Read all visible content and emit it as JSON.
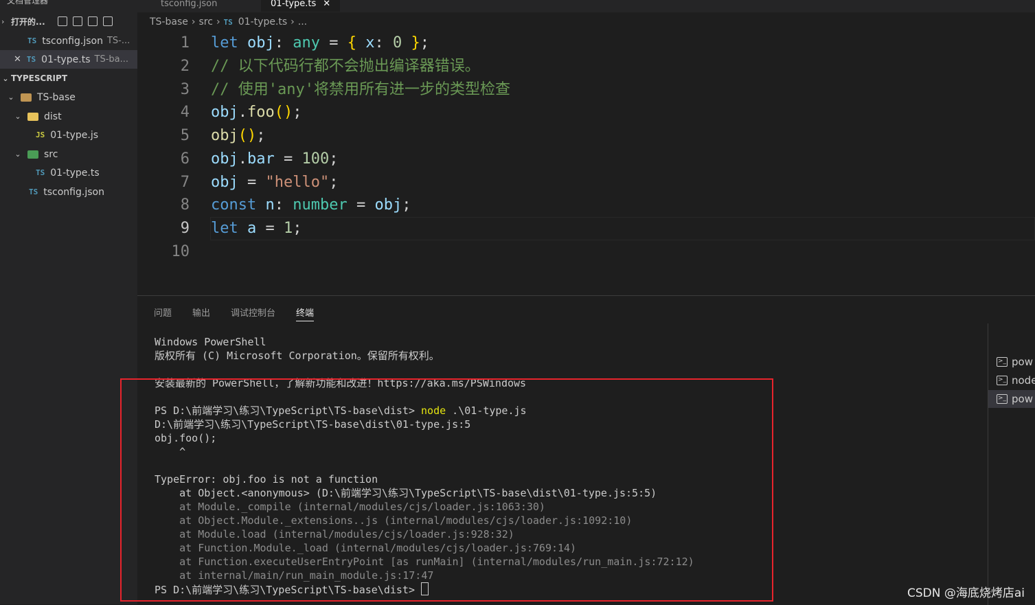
{
  "sidebar": {
    "cut_header": "文档管理器",
    "open_editors": {
      "title": "打开的...",
      "files": [
        {
          "tag": "TS",
          "name": "tsconfig.json",
          "desc": "TS-..."
        },
        {
          "tag": "TS",
          "name": "01-type.ts",
          "desc": "TS-ba..."
        }
      ]
    },
    "section_title": "TYPESCRIPT",
    "tree": {
      "root": "TS-base",
      "dist": "dist",
      "dist_file": {
        "tag": "JS",
        "name": "01-type.js"
      },
      "src": "src",
      "src_file": {
        "tag": "TS",
        "name": "01-type.ts"
      },
      "config_file": {
        "tag": "TS",
        "name": "tsconfig.json"
      }
    }
  },
  "tabs": [
    "tsconfig.json",
    "01-type.ts"
  ],
  "breadcrumb": {
    "a": "TS-base",
    "b": "src",
    "tag": "TS",
    "c": "01-type.ts",
    "d": "..."
  },
  "editor": {
    "line_numbers": [
      "1",
      "2",
      "3",
      "4",
      "5",
      "6",
      "7",
      "8",
      "9",
      "10"
    ],
    "comment1": "// 以下代码行都不会抛出编译器错误。",
    "comment2": "// 使用'any'将禁用所有进一步的类型检查",
    "tok": {
      "let": "let",
      "const": "const",
      "obj": "obj",
      "any": "any",
      "number": "number",
      "x": "x",
      "zero": "0",
      "foo": "foo",
      "bar": "bar",
      "n": "n",
      "a": "a",
      "hundred": "100",
      "hello": "\"hello\"",
      "one": "1"
    }
  },
  "panel": {
    "tabs": [
      "问题",
      "输出",
      "调试控制台",
      "终端"
    ],
    "active_tab": "终端",
    "terminal": {
      "l1": "Windows PowerShell",
      "l2": "版权所有 (C) Microsoft Corporation。保留所有权利。",
      "l3": "安装最新的 PowerShell，了解新功能和改进！https://aka.ms/PSWindows",
      "prompt": "PS D:\\前端学习\\练习\\TypeScript\\TS-base\\dist> ",
      "cmd": "node",
      "cmd_arg": " .\\01-type.js",
      "l5": "D:\\前端学习\\练习\\TypeScript\\TS-base\\dist\\01-type.js:5",
      "l6": "obj.foo();",
      "l7": "    ^",
      "l8": "TypeError: obj.foo is not a function",
      "l9": "    at Object.<anonymous> (D:\\前端学习\\练习\\TypeScript\\TS-base\\dist\\01-type.js:5:5)",
      "stack": [
        "    at Module._compile (internal/modules/cjs/loader.js:1063:30)",
        "    at Object.Module._extensions..js (internal/modules/cjs/loader.js:1092:10)",
        "    at Module.load (internal/modules/cjs/loader.js:928:32)",
        "    at Function.Module._load (internal/modules/cjs/loader.js:769:14)",
        "    at Function.executeUserEntryPoint [as runMain] (internal/modules/run_main.js:72:12)",
        "    at internal/main/run_main_module.js:17:47"
      ],
      "final_prompt": "PS D:\\前端学习\\练习\\TypeScript\\TS-base\\dist> "
    },
    "terminal_list": [
      "pow",
      "node",
      "pow"
    ]
  },
  "watermark": "CSDN @海底烧烤店ai",
  "colors": {
    "highlight_box": "#e8242c",
    "accent": "#007acc"
  }
}
